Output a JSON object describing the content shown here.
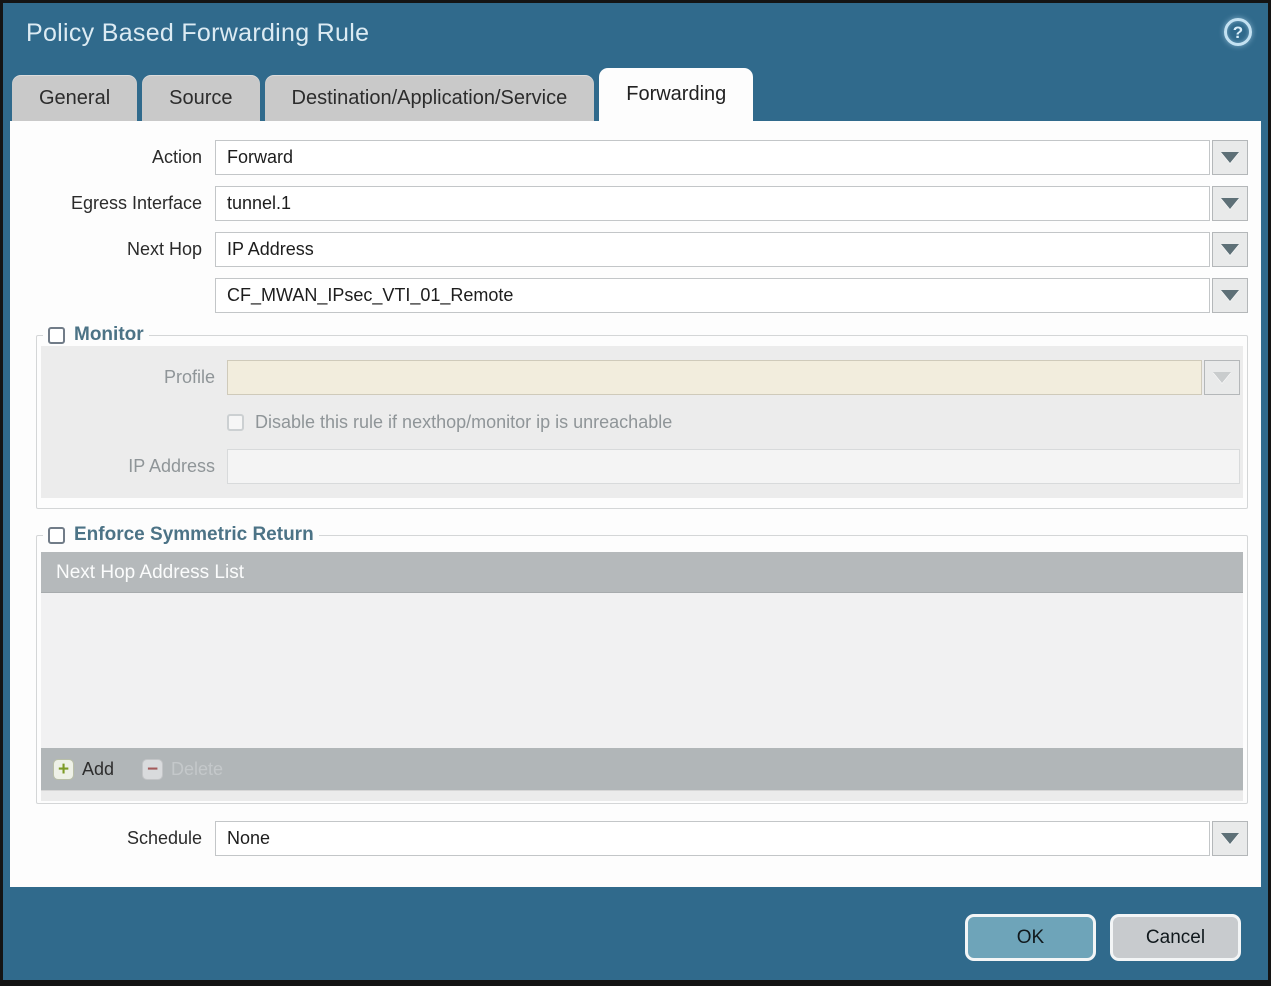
{
  "window": {
    "title": "Policy Based Forwarding Rule"
  },
  "icons": {
    "help": "?",
    "add": "+",
    "delete": "−"
  },
  "tabs": [
    {
      "label": "General",
      "active": false
    },
    {
      "label": "Source",
      "active": false
    },
    {
      "label": "Destination/Application/Service",
      "active": false
    },
    {
      "label": "Forwarding",
      "active": true
    }
  ],
  "form": {
    "action_label": "Action",
    "action_value": "Forward",
    "egress_label": "Egress Interface",
    "egress_value": "tunnel.1",
    "next_hop_label": "Next Hop",
    "next_hop_value": "IP Address",
    "next_hop_address_value": "CF_MWAN_IPsec_VTI_01_Remote",
    "schedule_label": "Schedule",
    "schedule_value": "None"
  },
  "monitor": {
    "legend": "Monitor",
    "checked": false,
    "profile_label": "Profile",
    "profile_value": "",
    "disable_rule_label": "Disable this rule if nexthop/monitor ip is unreachable",
    "disable_rule_checked": false,
    "ip_address_label": "IP Address",
    "ip_address_value": ""
  },
  "enforce_symmetric_return": {
    "legend": "Enforce Symmetric Return",
    "checked": false,
    "table_header": "Next Hop Address List",
    "rows": [],
    "add_label": "Add",
    "delete_label": "Delete"
  },
  "buttons": {
    "ok": "OK",
    "cancel": "Cancel"
  },
  "colors": {
    "titlebar_bg": "#306a8c",
    "legend_text": "#4c7386",
    "profile_field_bg": "#f2eddd",
    "table_header_bg": "#b5b9bb",
    "ok_button_bg": "#6ea4b9",
    "cancel_button_bg": "#c8cbce"
  }
}
